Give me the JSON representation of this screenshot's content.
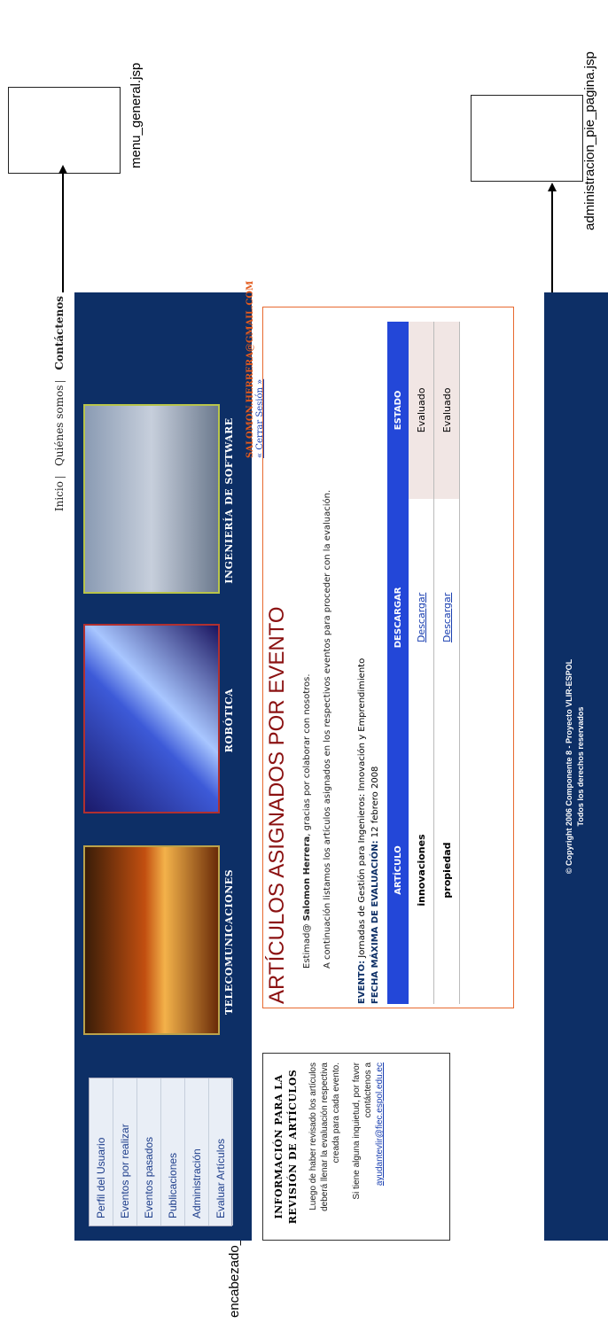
{
  "annotations": {
    "menu_general": "menu_general.jsp",
    "pie_pagina": "administracion_pie_pagina.jsp",
    "encabezado": "encabezado_evento.jsp"
  },
  "topnav": {
    "inicio": "Inicio",
    "quienes": "Quiénes somos",
    "contacto": "Contáctenos"
  },
  "menu": {
    "items": [
      "Perfil del Usuario",
      "Eventos por realizar",
      "Eventos pasados",
      "Publicaciones",
      "Administración",
      "Evaluar Artículos"
    ]
  },
  "tiles": {
    "t1": "TELECOMUNICACIONES",
    "t2": "ROBÓTICA",
    "t3": "INGENIERÍA DE SOFTWARE"
  },
  "sidebox": {
    "title_1": "INFORMACIÓN PARA LA",
    "title_2": "REVISIÓN DE ARTÍCULOS",
    "p1": "Luego de haber revisado los artículos deberá llenar la evaluación respectiva creada para cada evento.",
    "p2": "Si tiene alguna inquietud, por favor contáctenos a",
    "mail": "ayudantevlir@fiec.espol.edu.ec"
  },
  "main": {
    "email": "SALOMON.HERRERA@GMAIL.COM",
    "logout": "« Cerrar Sesión »",
    "title": "ARTÍCULOS ASIGNADOS POR EVENTO",
    "greet_pre": "Estimad@",
    "greet_name": "Salomon Herrera",
    "greet_post": ", gracias por colaborar con nosotros.",
    "intro": "A continuación listamos los artículos asignados en los respectivos eventos para proceder con la evaluación.",
    "evento_lbl": "EVENTO:",
    "evento_val": "Jornadas de Gestión para Ingenieros: Innovación y Emprendimiento",
    "fecha_lbl": "FECHA MÁXIMA DE EVALUACIÓN:",
    "fecha_val": "12 febrero 2008",
    "th_articulo": "ARTÍCULO",
    "th_descargar": "DESCARGAR",
    "th_estado": "ESTADO",
    "rows": [
      {
        "articulo": "innovaciones",
        "descargar": "Descargar",
        "estado": "Evaluado"
      },
      {
        "articulo": "propiedad",
        "descargar": "Descargar",
        "estado": "Evaluado"
      }
    ]
  },
  "footer": {
    "line1": "© Copyright 2006 Componente 8 - Proyecto VLIR-ESPOL",
    "line2": "Todos los derechos reservados"
  }
}
